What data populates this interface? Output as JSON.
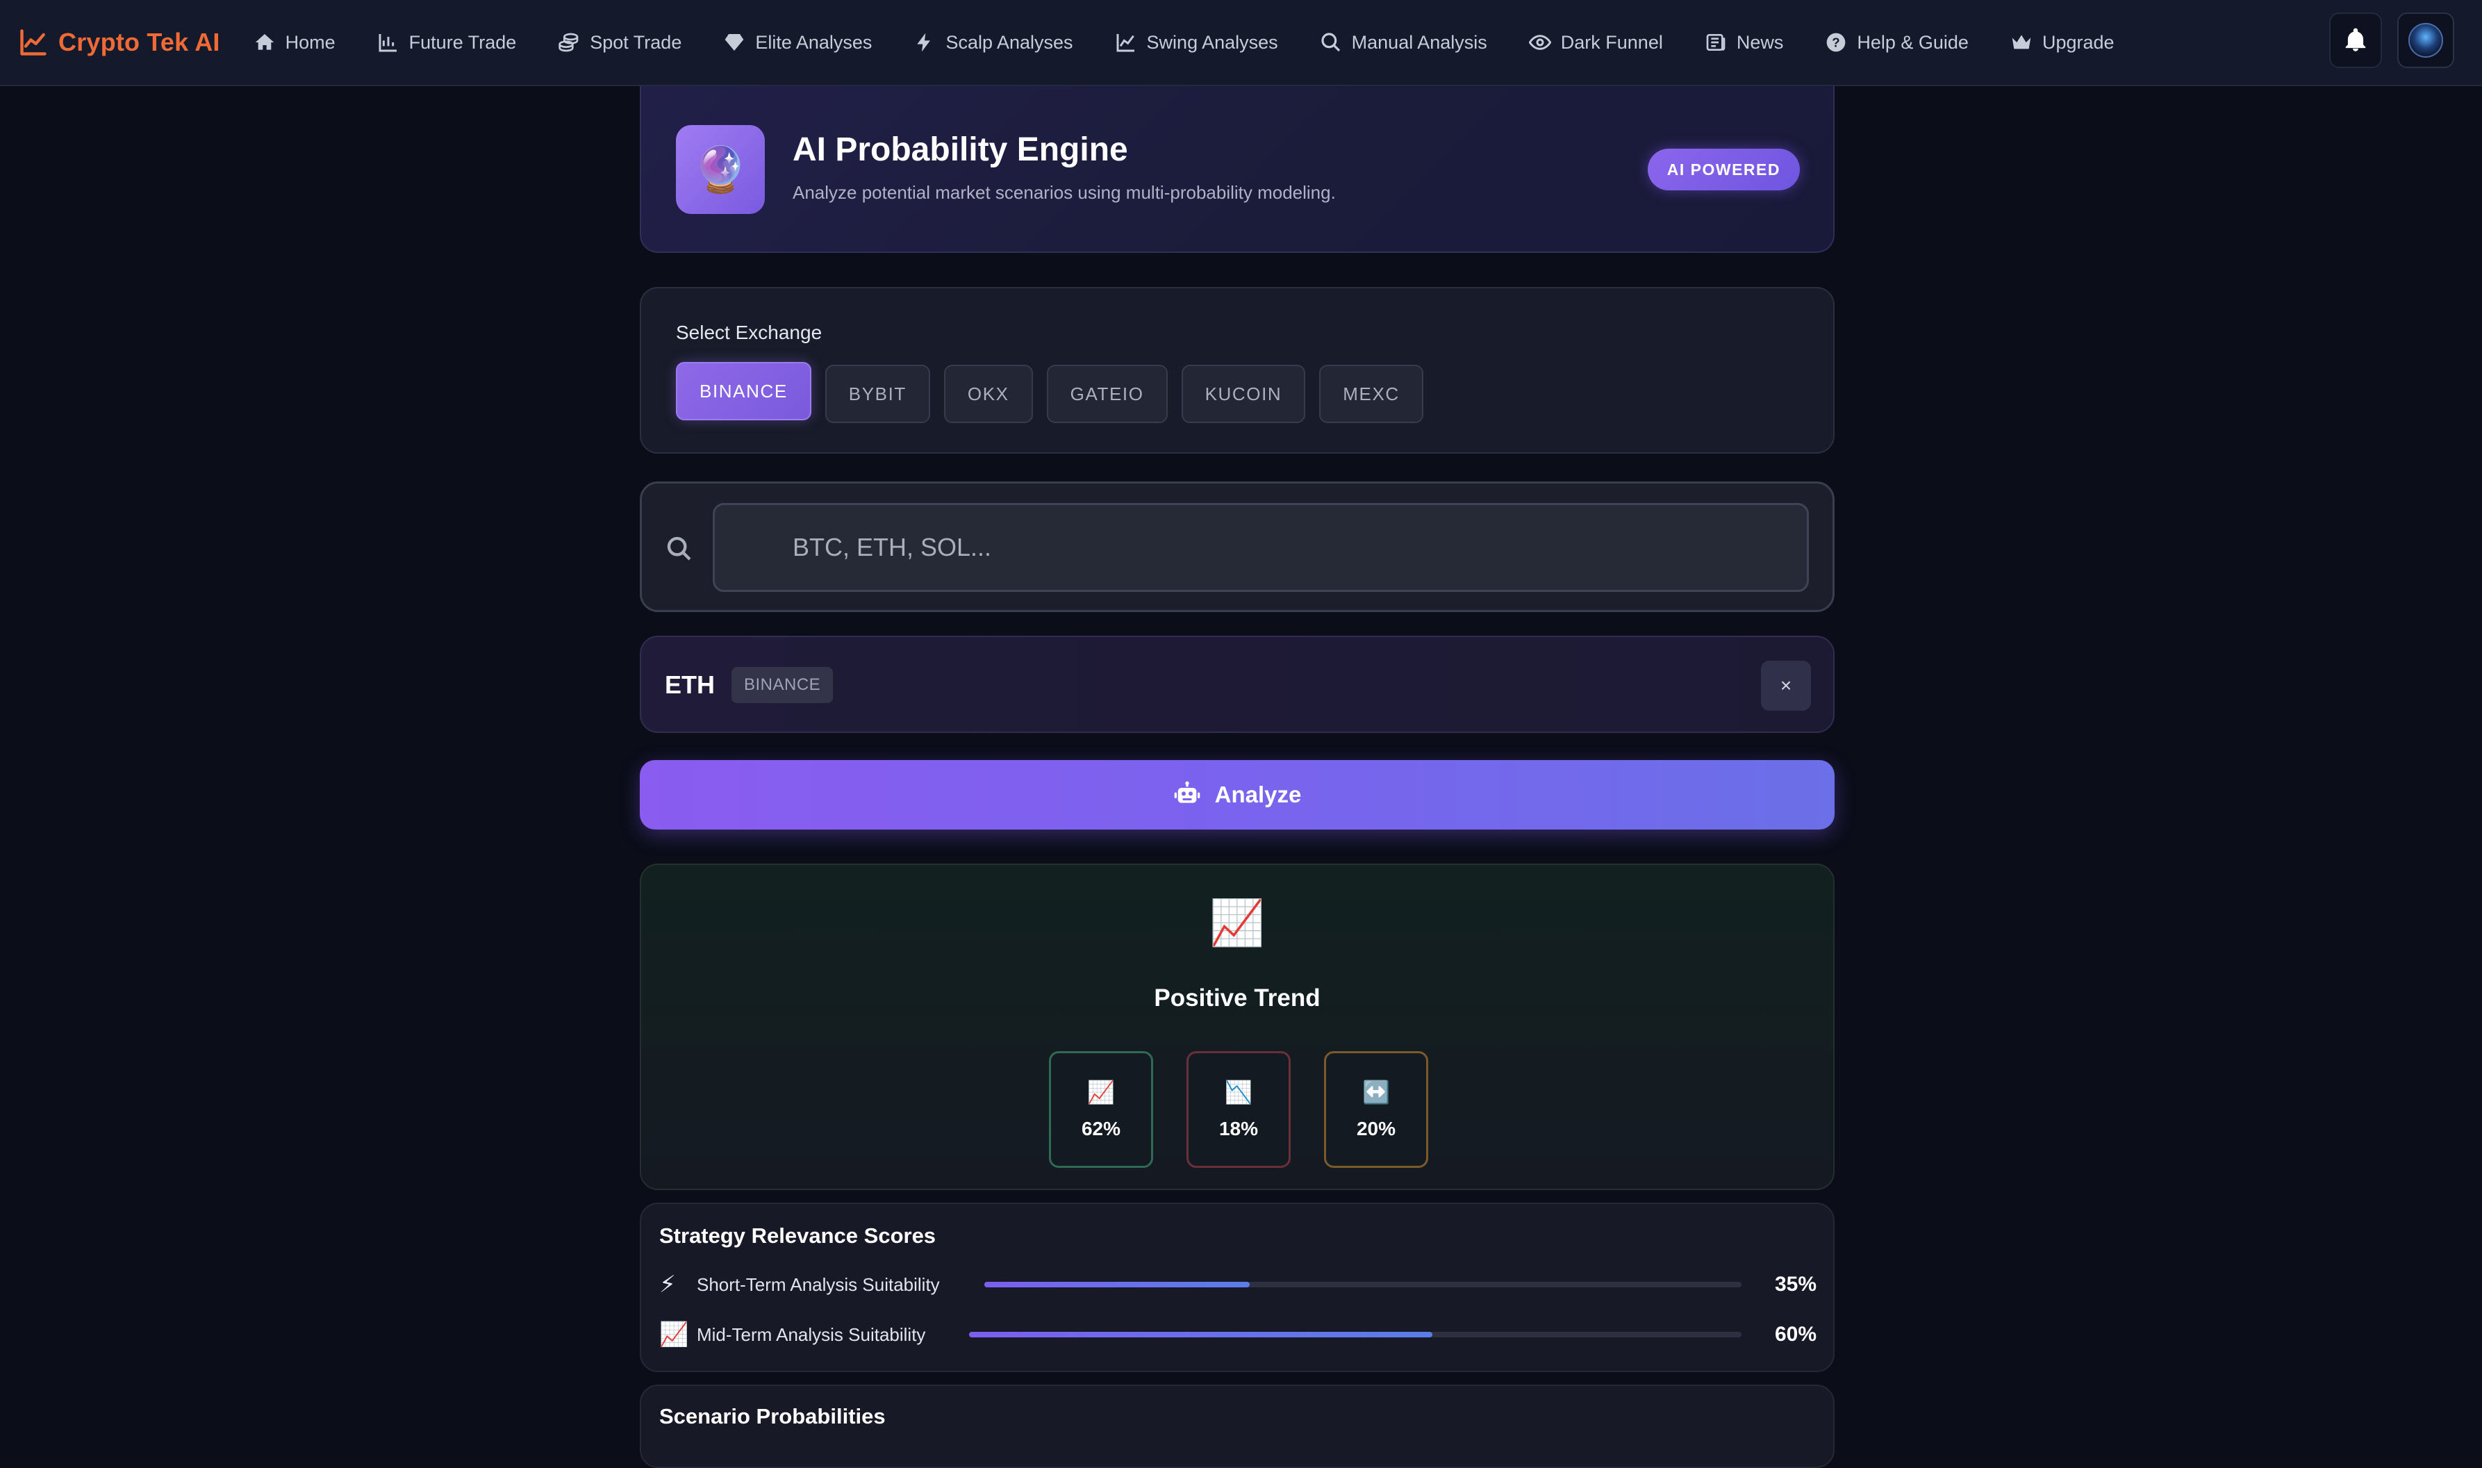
{
  "brand": {
    "name": "Crypto Tek AI",
    "color": "#ef6a35"
  },
  "nav": {
    "items": [
      {
        "label": "Home",
        "icon": "home-icon"
      },
      {
        "label": "Future Trade",
        "icon": "chart-bar-icon"
      },
      {
        "label": "Spot Trade",
        "icon": "coins-icon"
      },
      {
        "label": "Elite Analyses",
        "icon": "gem-icon"
      },
      {
        "label": "Scalp Analyses",
        "icon": "bolt-icon"
      },
      {
        "label": "Swing Analyses",
        "icon": "line-chart-icon"
      },
      {
        "label": "Manual Analysis",
        "icon": "search-icon"
      },
      {
        "label": "Dark Funnel",
        "icon": "eye-icon"
      },
      {
        "label": "News",
        "icon": "newspaper-icon"
      },
      {
        "label": "Help & Guide",
        "icon": "question-circle-icon"
      },
      {
        "label": "Upgrade",
        "icon": "crown-icon"
      }
    ]
  },
  "header": {
    "title": "AI Probability Engine",
    "subtitle": "Analyze potential market scenarios using multi-probability modeling.",
    "badge": "AI POWERED",
    "icon": "crystal-ball-icon"
  },
  "exchange": {
    "label": "Select Exchange",
    "options": [
      "BINANCE",
      "BYBIT",
      "OKX",
      "GATEIO",
      "KUCOIN",
      "MEXC"
    ],
    "selected": "BINANCE"
  },
  "search": {
    "placeholder": "BTC, ETH, SOL...",
    "value": ""
  },
  "selected_asset": {
    "symbol": "ETH",
    "exchange": "BINANCE",
    "close_label": "×"
  },
  "analyze": {
    "label": "Analyze",
    "icon": "robot-icon"
  },
  "trend": {
    "icon": "📈",
    "label": "Positive Trend",
    "probabilities": [
      {
        "icon": "📈",
        "value": "62%",
        "kind": "up"
      },
      {
        "icon": "📉",
        "value": "18%",
        "kind": "down"
      },
      {
        "icon": "↔️",
        "value": "20%",
        "kind": "sideways"
      }
    ]
  },
  "strategy": {
    "title": "Strategy Relevance Scores",
    "rows": [
      {
        "icon": "⚡",
        "label": "Short-Term Analysis Suitability",
        "value": "35%",
        "fraction": 0.35
      },
      {
        "icon": "📈",
        "label": "Mid-Term Analysis Suitability",
        "value": "60%",
        "fraction": 0.6
      }
    ]
  },
  "scenario": {
    "title": "Scenario Probabilities"
  },
  "colors": {
    "accent": "#7c5cee",
    "background": "#0b0d19",
    "positive": "#2f6a55",
    "negative": "#6b2f3a",
    "neutral": "#7c5a2a"
  }
}
